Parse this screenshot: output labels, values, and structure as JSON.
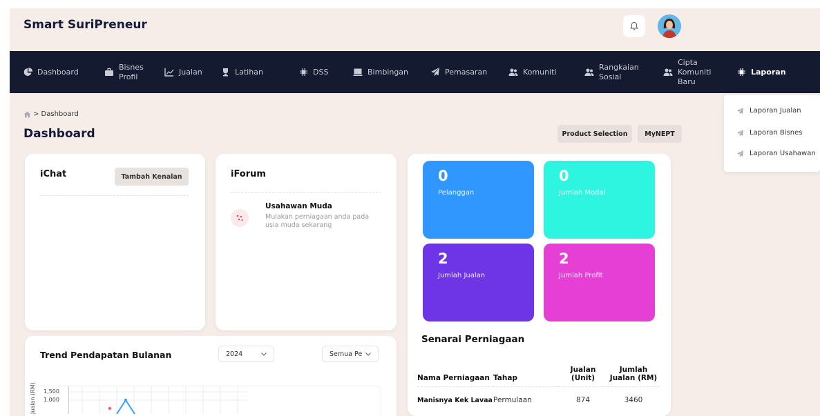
{
  "brand": "Smart SuriPreneur",
  "nav": [
    {
      "label": "Dashboard",
      "icon": "pie-chart-icon"
    },
    {
      "label": "Bisnes\nProfil",
      "icon": "briefcase-icon"
    },
    {
      "label": "Jualan",
      "icon": "chart-icon"
    },
    {
      "label": "Latihan",
      "icon": "trophy-icon"
    },
    {
      "label": "DSS",
      "icon": "chip-icon"
    },
    {
      "label": "Bimbingan",
      "icon": "book-icon"
    },
    {
      "label": "Pemasaran",
      "icon": "rocket-icon"
    },
    {
      "label": "Komuniti",
      "icon": "users-icon"
    },
    {
      "label": "Rangkaian\nSosial",
      "icon": "users-icon"
    },
    {
      "label": "Cipta\nKomuniti\nBaru",
      "icon": "users-icon"
    },
    {
      "label": "Laporan",
      "icon": "chip-icon"
    }
  ],
  "breadcrumb": "> Dashboard",
  "page_title": "Dashboard",
  "actions": {
    "product_selection": "Product Selection",
    "mynept": "MyNEPT"
  },
  "laporan_menu": [
    "Laporan Jualan",
    "Laporan Bisnes",
    "Laporan Usahawan"
  ],
  "ichat": {
    "title": "iChat",
    "button": "Tambah Kenalan"
  },
  "iforum": {
    "title": "iForum",
    "item_title": "Usahawan Muda",
    "item_desc": "Mulakan perniagaan anda pada usia muda sekarang"
  },
  "stats": [
    {
      "value": "0",
      "label": "Pelanggan",
      "color": "#2f97ff"
    },
    {
      "value": "0",
      "label": "Jumlah Modal",
      "color": "#2ef5e0"
    },
    {
      "value": "2",
      "label": "Jumlah Jualan",
      "color": "#6d35e6"
    },
    {
      "value": "2",
      "label": "Jumlah Profit",
      "color": "#e63fd6"
    }
  ],
  "trend": {
    "title": "Trend Pendapatan Bulanan",
    "year": "2024",
    "filter": "Semua Pe",
    "ylabel": "Jualan (RM)",
    "yticks": [
      "1,500",
      "1,000"
    ]
  },
  "senarai": {
    "title": "Senarai Perniagaan",
    "headers": [
      "Nama Perniagaan",
      "Tahap",
      "Jualan (Unit)",
      "Jumlah Jualan (RM)"
    ],
    "rows": [
      [
        "Manisnya Kek Lavaa",
        "Permulaan",
        "874",
        "3460"
      ]
    ]
  }
}
